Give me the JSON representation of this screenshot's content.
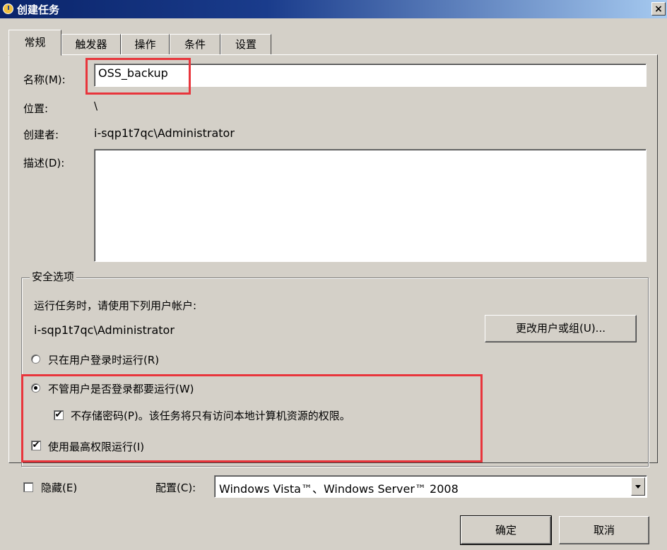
{
  "window": {
    "title": "创建任务",
    "close_label": "×"
  },
  "tabs": [
    {
      "label": "常规"
    },
    {
      "label": "触发器"
    },
    {
      "label": "操作"
    },
    {
      "label": "条件"
    },
    {
      "label": "设置"
    }
  ],
  "general": {
    "name_label": "名称(M):",
    "name_value": "OSS_backup",
    "location_label": "位置:",
    "location_value": "\\",
    "author_label": "创建者:",
    "author_value": "i-sqp1t7qc\\Administrator",
    "description_label": "描述(D):",
    "description_value": ""
  },
  "security": {
    "group_title": "安全选项",
    "run_as_text": "运行任务时，请使用下列用户帐户:",
    "user_account": "i-sqp1t7qc\\Administrator",
    "change_user_button": "更改用户或组(U)...",
    "radio_logged_on": {
      "label": "只在用户登录时运行(R)",
      "checked": false
    },
    "radio_whether_logged_on": {
      "label": "不管用户是否登录都要运行(W)",
      "checked": true
    },
    "do_not_store_password": {
      "label": "不存储密码(P)。该任务将只有访问本地计算机资源的权限。",
      "checked": true
    },
    "run_highest_privileges": {
      "label": "使用最高权限运行(I)",
      "checked": true
    }
  },
  "footer": {
    "hidden_label": "隐藏(E)",
    "hidden_checked": false,
    "config_label": "配置(C):",
    "config_value": "Windows Vista™、Windows Server™ 2008",
    "ok_button": "确定",
    "cancel_button": "取消"
  },
  "check_mark": "✔",
  "colors": {
    "highlight_box": "#e8353c",
    "title_bar": "#0a246a"
  }
}
